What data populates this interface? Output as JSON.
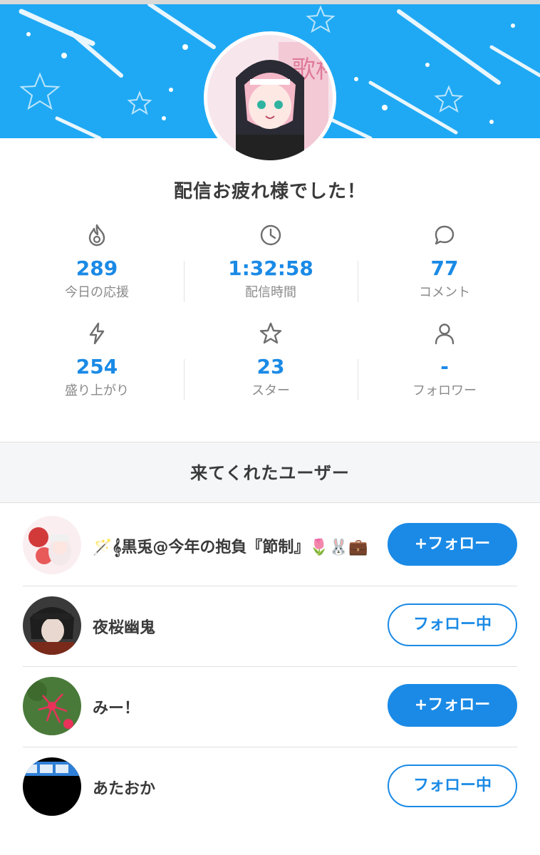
{
  "headline": "配信お疲れ様でした！",
  "accent_color": "#1a8ae6",
  "banner_color": "#1fa9f4",
  "streamer_avatar": {
    "icon": "avatar-icon",
    "art_text": "歌枠"
  },
  "stats": [
    {
      "icon": "flame-icon",
      "value": "289",
      "label": "今日の応援"
    },
    {
      "icon": "clock-icon",
      "value": "1:32:58",
      "label": "配信時間"
    },
    {
      "icon": "comment-icon",
      "value": "77",
      "label": "コメント"
    },
    {
      "icon": "lightning-icon",
      "value": "254",
      "label": "盛り上がり"
    },
    {
      "icon": "star-icon",
      "value": "23",
      "label": "スター"
    },
    {
      "icon": "person-icon",
      "value": "-",
      "label": "フォロワー"
    }
  ],
  "visitors_title": "来てくれたユーザー",
  "visitors": [
    {
      "name": "🪄𝄞黒兎@今年の抱負『節制』🌷🐰💼",
      "button": "+フォロー",
      "following": false
    },
    {
      "name": "夜桜幽鬼",
      "button": "フォロー中",
      "following": true
    },
    {
      "name": "みー！",
      "button": "+フォロー",
      "following": false
    },
    {
      "name": "あたおか",
      "button": "フォロー中",
      "following": true
    }
  ]
}
